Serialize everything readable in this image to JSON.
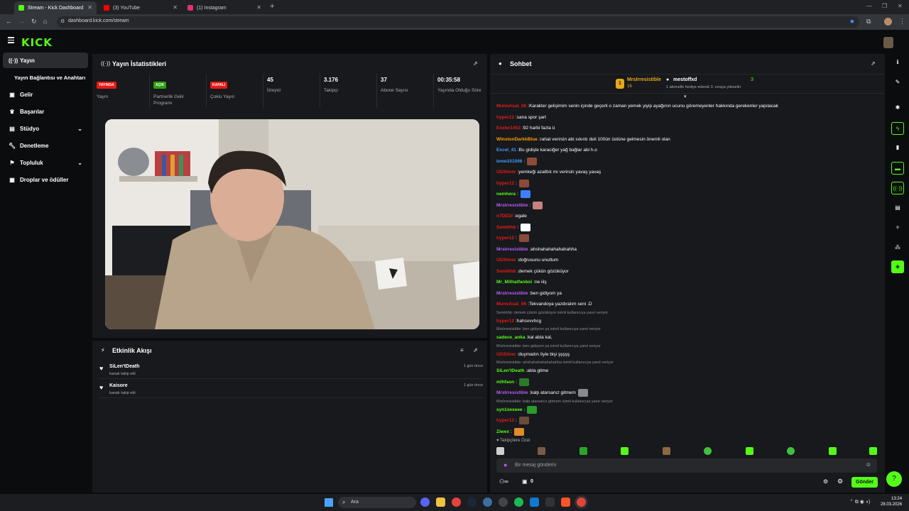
{
  "browser": {
    "tabs": [
      {
        "title": "Stream - Kick Dashboard",
        "active": true,
        "favicon_color": "#53fc18"
      },
      {
        "title": "(3) YouTube",
        "active": false,
        "favicon_color": "#ff0000"
      },
      {
        "title": "(1) Instagram",
        "active": false,
        "favicon_color": "#e1306c"
      }
    ],
    "url": "dashboard.kick.com/stream"
  },
  "header": {
    "logo": "KICK"
  },
  "sidebar": {
    "items": [
      {
        "label": "Yayın",
        "icon": "broadcast-icon",
        "active": true
      },
      {
        "label": "Yayın Bağlantısı ve Anahtarı",
        "icon": "",
        "active": false
      },
      {
        "label": "Gelir",
        "icon": "money-icon",
        "active": false
      },
      {
        "label": "Başarılar",
        "icon": "trophy-icon",
        "active": false
      },
      {
        "label": "Stüdyo",
        "icon": "studio-icon",
        "active": false,
        "chevron": true
      },
      {
        "label": "Denetleme",
        "icon": "wrench-icon",
        "active": false
      },
      {
        "label": "Topluluk",
        "icon": "community-icon",
        "active": false,
        "chevron": true
      },
      {
        "label": "Droplar ve ödüller",
        "icon": "drops-icon",
        "active": false
      }
    ]
  },
  "stats_panel": {
    "title": "Yayın İstatistikleri",
    "stats": [
      {
        "badge": "YAYINDA",
        "badge_color": "#e91916",
        "label": "Yayın"
      },
      {
        "badge": "AÇIK",
        "badge_color": "#2ea10a",
        "label": "Partnerlik Gelir Programı"
      },
      {
        "badge": "KAPALI",
        "badge_color": "#e91916",
        "label": "Çoklu Yayın"
      },
      {
        "value": "45",
        "label": "İzleyici"
      },
      {
        "value": "3.176",
        "label": "Takipçi"
      },
      {
        "value": "37",
        "label": "Abone Sayısı"
      },
      {
        "value": "00:35:58",
        "label": "Yayında Olduğu Süre"
      }
    ]
  },
  "activity": {
    "title": "Etkinlik Akışı",
    "items": [
      {
        "name": "SiLen'tDeath",
        "sub": "kanalı takip etti",
        "time": "1 gün önce"
      },
      {
        "name": "Kaisore",
        "sub": "kanalı takip etti",
        "time": "1 gün önce"
      }
    ]
  },
  "chat": {
    "title": "Sohbet",
    "pinned": {
      "user1": "MrsIrresistible",
      "user1_count": "16",
      "user2": "mestoffxd",
      "note": "1 abonelik hediye ederek 3. sıraya yükselin",
      "count": "3"
    },
    "messages": [
      {
        "user": "MunoAsat_06",
        "color": "#e91916",
        "text": "Karakter gelişimim senin içinde geçerli o zaman yemek yiyip ayağının ucunu göremeyenler hakkında gerekenler yapılacak"
      },
      {
        "user": "hyper12",
        "color": "#e91916",
        "text": "sana spor şart"
      },
      {
        "user": "Exeler1453",
        "color": "#e91916",
        "text": "92 harbi fazla ü"
      },
      {
        "user": "WinstonDarkkBlue",
        "color": "#ff9d00",
        "text": "rahat verirsin abi sıkıntı deil 100ün üstüne gelmesin önemli olan"
      },
      {
        "user": "Excel_41",
        "color": "#3f9cff",
        "text": "Bu gidişle karaciğer yağ bağlar abi h.o"
      },
      {
        "user": "bmw101006",
        "color": "#3f9cff",
        "text": "",
        "emote": "#8a4b3a"
      },
      {
        "user": "UGSilver",
        "color": "#e91916",
        "text": "yemkeği azalttık mı verirsin yavaş yavaş"
      },
      {
        "user": "hyper12",
        "color": "#e91916",
        "text": "",
        "emote": "#8a4b3a"
      },
      {
        "user": "nemhera",
        "color": "#53fc18",
        "text": "",
        "emote": "#3f7fff"
      },
      {
        "user": "MrsIrresistible",
        "color": "#b65cff",
        "text": "",
        "emote": "#c98080"
      },
      {
        "user": "n7DEDI",
        "color": "#e91916",
        "text": "egale"
      },
      {
        "user": "Semihhb",
        "color": "#e91916",
        "text": "",
        "emote": "#ffffff"
      },
      {
        "user": "hyper12",
        "color": "#e91916",
        "text": "",
        "emote": "#8a4b3a"
      },
      {
        "user": "MrsIrresistible",
        "color": "#b65cff",
        "text": "ahshahahahahahahha"
      },
      {
        "user": "UGSilver",
        "color": "#e91916",
        "text": "doğrusunu unuttum"
      },
      {
        "user": "Semihhb",
        "color": "#e91916",
        "text": "demek çükün gözüküyor"
      },
      {
        "user": "Mr_Mithatfanboi",
        "color": "#53fc18",
        "text": "ne iiiş"
      },
      {
        "user": "MrsIrresistible",
        "color": "#b65cff",
        "text": "ben gidiyom ya"
      },
      {
        "user": "MunoAsat_06",
        "color": "#e91916",
        "text": "Tekvandoya yazdıralım seni .D"
      },
      {
        "reply": "Semihhb: demek çükün gözüküyor isimli kullanıcıya yanıt veriyor"
      },
      {
        "user": "hyper12",
        "color": "#e91916",
        "text": "hahsxvvhcg"
      },
      {
        "reply": "MrsIrresistible: ben gidiyom ya isimli kullanıcıya yanıt veriyor"
      },
      {
        "user": "sadece_anka",
        "color": "#53fc18",
        "text": "kal abla kal,"
      },
      {
        "reply": "MrsIrresistible: ben gidiyom ya isimli kullanıcıya yanıt veriyor"
      },
      {
        "user": "UGSilver",
        "color": "#e91916",
        "text": "duymadın öyle bişi şşşşş"
      },
      {
        "reply": "MrsIrresistible: ahshahahahahahahha isimli kullanıcıya yanıt veriyor"
      },
      {
        "user": "SiLen'tDeath",
        "color": "#53fc18",
        "text": "abla gitme"
      },
      {
        "user": "mlhfaon",
        "color": "#53fc18",
        "text": "",
        "emote": "#2a7a2a"
      },
      {
        "user": "MrsIrresistible",
        "color": "#b65cff",
        "text": "kalp atarsanız gitmem",
        "emote": "#8a8a8a"
      },
      {
        "reply": "MrsIrresistible: kalp atarsanız gitmem isimli kullanıcıya yanıt veriyor"
      },
      {
        "user": "syn1xexeee",
        "color": "#53fc18",
        "text": "",
        "emote": "#2a9a2a"
      },
      {
        "user": "hyper12",
        "color": "#e91916",
        "text": "",
        "emote": "#6b4b3a"
      },
      {
        "user": "Ziwex",
        "color": "#53fc18",
        "text": "",
        "emote": "#e08a2a"
      }
    ],
    "followers_only": "Takipçilere Özel",
    "input_placeholder": "Bir mesaj gönderin",
    "points": "0",
    "send_label": "Gönder"
  },
  "taskbar": {
    "search_placeholder": "Ara",
    "time": "13:24",
    "date": "28.03.2026"
  }
}
